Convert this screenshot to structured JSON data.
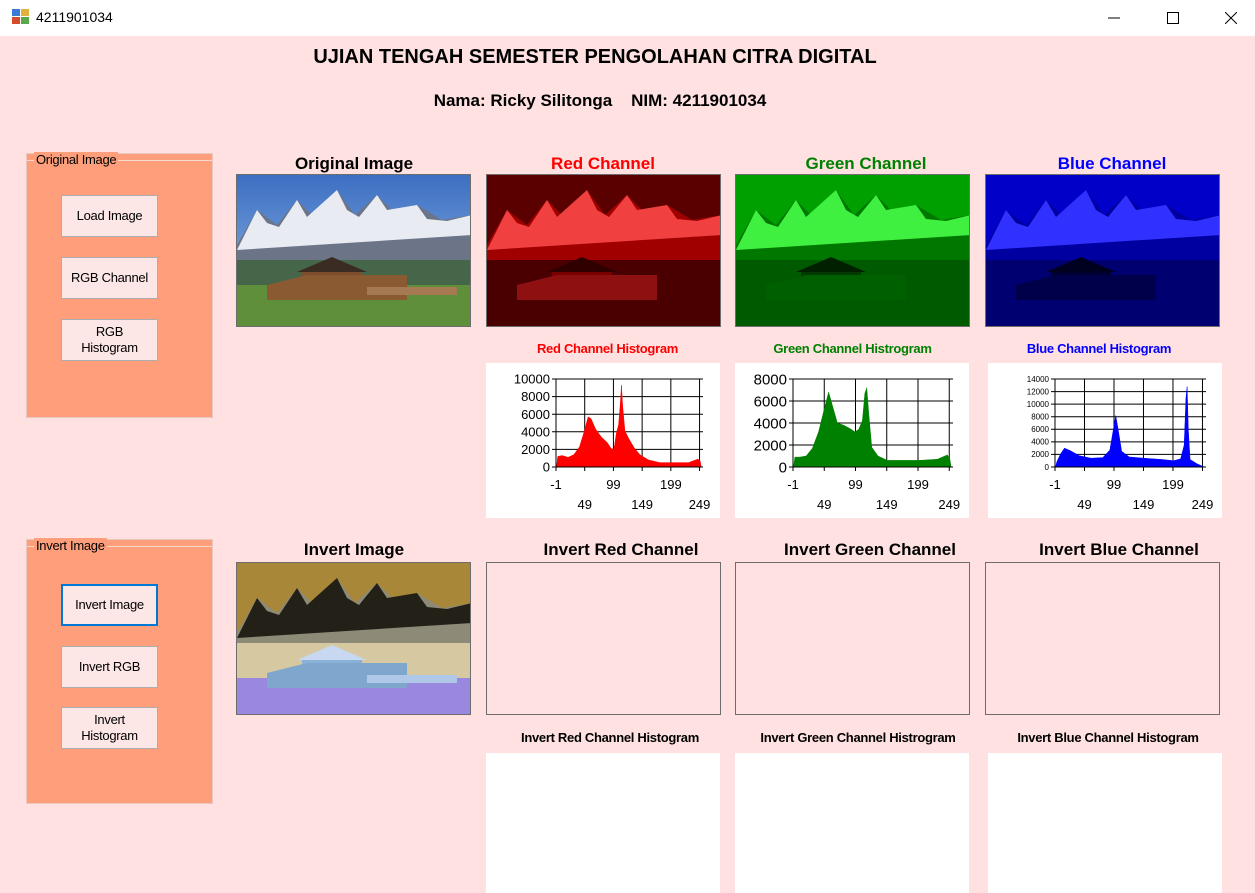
{
  "window": {
    "title": "4211901034",
    "minimize": "—",
    "maximize": "☐",
    "close": "✕"
  },
  "header": {
    "title": "UJIAN TENGAH SEMESTER PENGOLAHAN CITRA DIGITAL",
    "subtitle": "Nama: Ricky Silitonga    NIM: 4211901034"
  },
  "original_group": {
    "label": "Original Image",
    "buttons": [
      "Load Image",
      "RGB Channel",
      "RGB\nHistogram"
    ]
  },
  "invert_group": {
    "label": "Invert Image",
    "buttons": [
      "Invert Image",
      "Invert RGB",
      "Invert\nHistogram"
    ]
  },
  "titles": {
    "original": "Original Image",
    "red": "Red Channel",
    "green": "Green Channel",
    "blue": "Blue Channel",
    "red_hist": "Red Channel Histogram",
    "green_hist": "Green Channel Histrogram",
    "blue_hist": "Blue Channel Histogram",
    "invert": "Invert Image",
    "inv_red": "Invert Red Channel",
    "inv_green": "Invert Green Channel",
    "inv_blue": "Invert Blue Channel",
    "inv_red_hist": "Invert Red Channel Histogram",
    "inv_green_hist": "Invert Green Channel Histrogram",
    "inv_blue_hist": "Invert Blue Channel Histogram"
  },
  "colors": {
    "red_title": "#ff0000",
    "green_title": "#008000",
    "blue_title": "#0000ff",
    "red_series": "#ff0000",
    "green_series": "#008000",
    "blue_series": "#0000ff"
  },
  "chart_data": [
    {
      "type": "area",
      "series_name": "",
      "x_ticks_top": [
        "-1",
        "99",
        "199"
      ],
      "x_ticks_bottom": [
        "49",
        "149",
        "249"
      ],
      "y_ticks": [
        "10000",
        "8000",
        "6000",
        "4000",
        "2000",
        "0"
      ],
      "xlim": [
        -1,
        255
      ],
      "ylim": [
        0,
        10000
      ],
      "points": [
        [
          0,
          0
        ],
        [
          2,
          1200
        ],
        [
          10,
          1300
        ],
        [
          20,
          1100
        ],
        [
          30,
          1400
        ],
        [
          40,
          2300
        ],
        [
          48,
          4000
        ],
        [
          55,
          5700
        ],
        [
          60,
          5500
        ],
        [
          68,
          4300
        ],
        [
          78,
          3400
        ],
        [
          88,
          2800
        ],
        [
          95,
          2100
        ],
        [
          100,
          2000
        ],
        [
          104,
          3800
        ],
        [
          108,
          4800
        ],
        [
          111,
          7200
        ],
        [
          113,
          9300
        ],
        [
          115,
          7000
        ],
        [
          119,
          4100
        ],
        [
          126,
          3200
        ],
        [
          135,
          2200
        ],
        [
          145,
          1400
        ],
        [
          160,
          800
        ],
        [
          180,
          500
        ],
        [
          200,
          500
        ],
        [
          230,
          500
        ],
        [
          246,
          900
        ],
        [
          250,
          700
        ],
        [
          252,
          0
        ]
      ]
    },
    {
      "type": "area",
      "series_name": "",
      "x_ticks_top": [
        "-1",
        "99",
        "199"
      ],
      "x_ticks_bottom": [
        "49",
        "149",
        "249"
      ],
      "y_ticks": [
        "8000",
        "6000",
        "4000",
        "2000",
        "0"
      ],
      "xlim": [
        -1,
        255
      ],
      "ylim": [
        0,
        8000
      ],
      "points": [
        [
          0,
          0
        ],
        [
          2,
          900
        ],
        [
          10,
          900
        ],
        [
          20,
          1000
        ],
        [
          30,
          1700
        ],
        [
          40,
          3200
        ],
        [
          50,
          5500
        ],
        [
          56,
          6800
        ],
        [
          62,
          5600
        ],
        [
          70,
          4000
        ],
        [
          80,
          3800
        ],
        [
          90,
          3500
        ],
        [
          98,
          3200
        ],
        [
          104,
          3400
        ],
        [
          110,
          4200
        ],
        [
          114,
          6700
        ],
        [
          117,
          7200
        ],
        [
          120,
          5000
        ],
        [
          125,
          1800
        ],
        [
          135,
          1000
        ],
        [
          150,
          600
        ],
        [
          170,
          600
        ],
        [
          200,
          600
        ],
        [
          230,
          700
        ],
        [
          246,
          1100
        ],
        [
          250,
          700
        ],
        [
          252,
          0
        ]
      ]
    },
    {
      "type": "area",
      "series_name": "",
      "x_ticks_top": [
        "-1",
        "99",
        "199"
      ],
      "x_ticks_bottom": [
        "49",
        "149",
        "249"
      ],
      "y_ticks": [
        "14000",
        "12000",
        "10000",
        "8000",
        "6000",
        "4000",
        "2000",
        "0"
      ],
      "xlim": [
        -1,
        255
      ],
      "ylim": [
        0,
        14000
      ],
      "points": [
        [
          0,
          0
        ],
        [
          2,
          800
        ],
        [
          8,
          2000
        ],
        [
          15,
          3000
        ],
        [
          25,
          2600
        ],
        [
          40,
          1800
        ],
        [
          60,
          1400
        ],
        [
          80,
          1500
        ],
        [
          92,
          2700
        ],
        [
          98,
          6000
        ],
        [
          102,
          8200
        ],
        [
          106,
          6000
        ],
        [
          112,
          2500
        ],
        [
          125,
          1600
        ],
        [
          150,
          1400
        ],
        [
          180,
          1200
        ],
        [
          200,
          1000
        ],
        [
          212,
          1300
        ],
        [
          218,
          3500
        ],
        [
          221,
          11000
        ],
        [
          223,
          12800
        ],
        [
          225,
          6000
        ],
        [
          228,
          1200
        ],
        [
          240,
          500
        ],
        [
          252,
          0
        ]
      ]
    }
  ]
}
